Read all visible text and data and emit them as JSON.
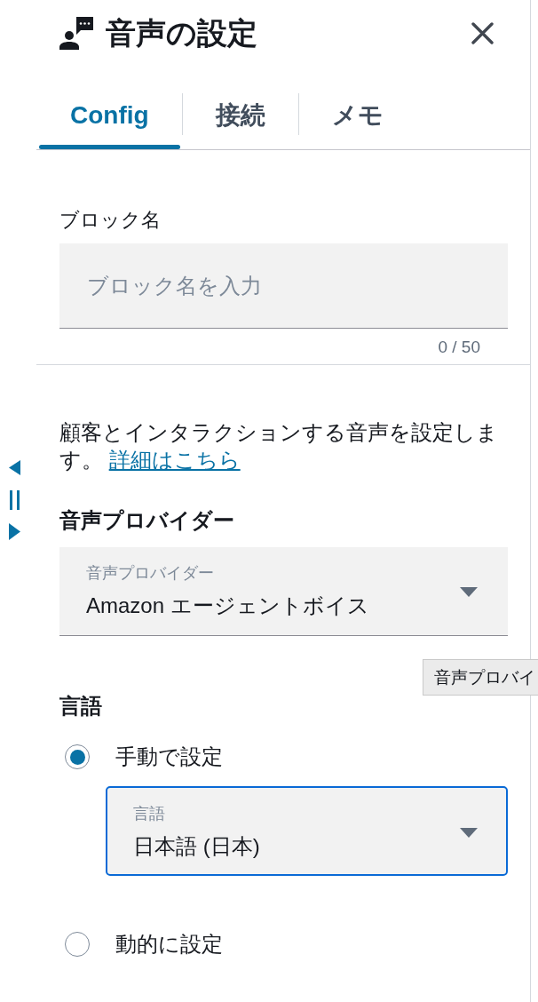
{
  "header": {
    "title": "音声の設定"
  },
  "tabs": [
    {
      "label": "Config",
      "selected": true
    },
    {
      "label": "接続",
      "selected": false
    },
    {
      "label": "メモ",
      "selected": false
    }
  ],
  "block_name": {
    "label": "ブロック名",
    "placeholder": "ブロック名を入力",
    "counter": "0 / 50"
  },
  "description": {
    "text": "顧客とインタラクションする音声を設定します。",
    "link": "詳細はこちら"
  },
  "voice_provider": {
    "heading": "音声プロバイダー",
    "select": {
      "label": "音声プロバイダー",
      "value": "Amazon エージェントボイス",
      "focused": false
    }
  },
  "tooltip": {
    "text": "音声プロバイ"
  },
  "language": {
    "heading": "言語",
    "options": [
      {
        "label": "手動で設定",
        "selected": true,
        "select": {
          "label": "言語",
          "value": "日本語 (日本)",
          "focused": true
        }
      },
      {
        "label": "動的に設定",
        "selected": false
      }
    ]
  }
}
